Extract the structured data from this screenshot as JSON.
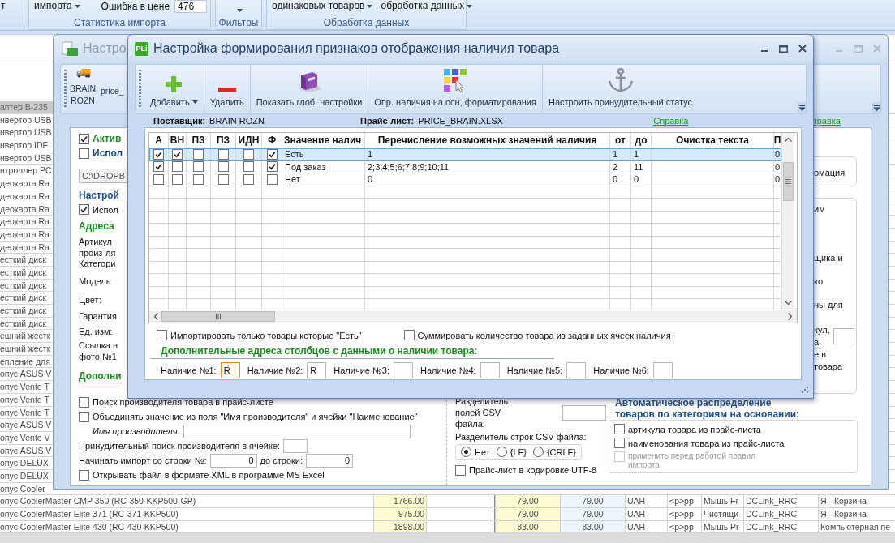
{
  "ribbon": {
    "fragment": "т",
    "groups": [
      {
        "label": "Статистика импорта",
        "items": [
          {
            "kind": "menu-button",
            "label": "импорта"
          },
          {
            "kind": "field",
            "label": "Ошибка в цене",
            "value": "476"
          }
        ]
      },
      {
        "label": "Фильтры",
        "items": [
          {
            "kind": "caret-button"
          }
        ]
      },
      {
        "label": "Обработка данных",
        "items": [
          {
            "kind": "menu-button",
            "label": "одинаковых товаров"
          },
          {
            "kind": "menu-button",
            "label": "обработка данных"
          }
        ]
      }
    ]
  },
  "product_list": {
    "rows": [
      {
        "name": "аптер B-235",
        "selected": true
      },
      {
        "name": "нвертор USB",
        "selected": false
      },
      {
        "name": "нвертор USB",
        "selected": false
      },
      {
        "name": "нвертор IDE",
        "selected": false
      },
      {
        "name": "нвертор USB",
        "selected": false
      },
      {
        "name": "нтроллер PC",
        "selected": false
      },
      {
        "name": "деокарта Ra",
        "selected": false
      },
      {
        "name": "деокарта Ra",
        "selected": false
      },
      {
        "name": "деокарта Ra",
        "selected": false
      },
      {
        "name": "деокарта Ra",
        "selected": false
      },
      {
        "name": "деокарта Ra",
        "selected": false
      },
      {
        "name": "деокарта Ra",
        "selected": false
      },
      {
        "name": "есткий диск",
        "selected": false
      },
      {
        "name": "есткий диск",
        "selected": false
      },
      {
        "name": "есткий диск",
        "selected": false
      },
      {
        "name": "есткий диск",
        "selected": false
      },
      {
        "name": "есткий диск",
        "selected": false
      },
      {
        "name": "есткий диск",
        "selected": false
      },
      {
        "name": "ешний жестк",
        "selected": false
      },
      {
        "name": "ешний жестк",
        "selected": false
      },
      {
        "name": "епление для",
        "selected": false
      },
      {
        "name": "опус ASUS V",
        "selected": false
      },
      {
        "name": "опус Vento T",
        "selected": false
      },
      {
        "name": "опус Vento T",
        "selected": false
      },
      {
        "name": "опус Vento T",
        "selected": false
      },
      {
        "name": "опус ASUS V",
        "selected": false
      },
      {
        "name": "опус Vento V",
        "selected": false
      },
      {
        "name": "опус ASUS V",
        "selected": false
      },
      {
        "name": "опус DELUX",
        "selected": false
      },
      {
        "name": "опус DELUX",
        "selected": false
      },
      {
        "name": "опус Cooler",
        "selected": false
      },
      {
        "name": "опус CoolerMaster CMP 350 (RC-350-KKP500-GP)",
        "selected": false,
        "cells": [
          "1766.00",
          "79.00",
          "79.00",
          "UAH",
          "<p>pp",
          "Мышь Fr",
          "DCLink_RRC",
          "Я - Корзина"
        ]
      },
      {
        "name": "опус CoolerMaster Elite 371 (RC-371-KKP500)",
        "selected": false,
        "cells": [
          "975.00",
          "79.00",
          "79.00",
          "UAH",
          "<p>pp",
          "Чистящи",
          "DCLink_RRC",
          "Я - Корзина"
        ]
      },
      {
        "name": "опус CoolerMaster Elite 430 (RC-430-KKP500)",
        "selected": false,
        "cells": [
          "1898.00",
          "83.00",
          "83.00",
          "UAH",
          "<p>pp",
          "Мышь Pr",
          "DCLink_RRC",
          "Компьютерная пе"
        ]
      }
    ]
  },
  "back_window": {
    "title": "Настро",
    "toolbar": [
      {
        "kind": "truck",
        "label": "BRAIN ROZN"
      },
      {
        "kind": "text",
        "label": "price_"
      }
    ],
    "help_link": "правка",
    "left_items": [
      {
        "kind": "main-checkbox",
        "label": "Актив",
        "checked": true
      },
      {
        "kind": "option-checkbox",
        "label": "Испол",
        "checked": false
      },
      {
        "kind": "path",
        "value": "C:\\DROPB"
      },
      {
        "kind": "group-title",
        "label": "Настрой"
      },
      {
        "kind": "checkbox",
        "label": "Испол",
        "checked": true
      },
      {
        "kind": "heading",
        "label": "Адреса"
      },
      {
        "kind": "label",
        "label": "Артикул произ-ля"
      },
      {
        "kind": "label",
        "label": "Категори"
      },
      {
        "kind": "label",
        "label": "Модель:"
      },
      {
        "kind": "label",
        "label": "Цвет:"
      },
      {
        "kind": "label",
        "label": "Гарантия"
      },
      {
        "kind": "label",
        "label": "Ед. изм:"
      },
      {
        "kind": "label",
        "label": "Ссылка н фото №1"
      },
      {
        "kind": "heading",
        "label": "Дополни"
      }
    ],
    "right_boxes": [
      {
        "items": [
          {
            "kind": "label",
            "label": "омация"
          }
        ]
      },
      {
        "items": [
          {
            "kind": "label",
            "label": "им"
          },
          {
            "kind": "label",
            "label": "щика и"
          },
          {
            "kind": "label",
            "label": "ко"
          },
          {
            "kind": "label",
            "label": "ны для"
          },
          {
            "kind": "field-label",
            "label": "кул, а:"
          },
          {
            "kind": "label",
            "label": "е в товара"
          }
        ]
      }
    ],
    "bottom_left": [
      {
        "kind": "checkbox",
        "label": "Поиск производителя товара в прайс-листе",
        "checked": false
      },
      {
        "kind": "checkbox",
        "label": "Объединять значение из поля \"Имя производителя\" и ячейки \"Наименование\"",
        "checked": false
      },
      {
        "kind": "indented-input",
        "label": "Имя производителя:"
      },
      {
        "kind": "input",
        "label": "Принудительный поиск производителя в ячейке:"
      },
      {
        "kind": "range",
        "label": "Начинать импорт со строки №:",
        "value": "0",
        "label2": "до строки:",
        "value2": "0"
      },
      {
        "kind": "checkbox",
        "label": "Открывать файл в формате XML в программе MS Excel",
        "checked": false
      }
    ],
    "csv": {
      "field_separator": "Разделитель полей CSV файла:",
      "line_separator": "Разделитель строк CSV файла:",
      "options": [
        {
          "label": "Нет",
          "selected": true
        },
        {
          "label": "{LF}",
          "selected": false
        },
        {
          "label": "{CRLF}",
          "selected": false
        }
      ],
      "utf8": {
        "label": "Прайс-лист в кодировке UTF-8",
        "checked": false
      }
    },
    "auto": {
      "title": "Автоматическое распределение товаров по категориям на основании:",
      "options": [
        {
          "label": "артикула товара из прайс-листа",
          "checked": false,
          "disabled": false
        },
        {
          "label": "наименования товара из прайс-листа",
          "checked": false,
          "disabled": false
        },
        {
          "label": "применить перед работой правил импорта",
          "checked": false,
          "disabled": true
        }
      ]
    }
  },
  "dialog": {
    "logo": "PLi",
    "title": "Настройка формирования признаков отображения наличия товара",
    "toolbar": [
      {
        "kind": "add",
        "label": "Добавить",
        "dropdown": true
      },
      {
        "kind": "remove",
        "label": "Удалить",
        "dropdown": false
      },
      {
        "kind": "book",
        "label": "Показать глоб. настройки",
        "dropdown": false
      },
      {
        "kind": "palette",
        "label": "Опр. наличия на осн, форматирования",
        "dropdown": false
      },
      {
        "kind": "anchor",
        "label": "Настроить принудительный статус",
        "dropdown": false
      }
    ],
    "supplier_label": "Поставщик:",
    "supplier": "BRAIN ROZN",
    "pricelist_label": "Прайс-лист:",
    "pricelist": "PRICE_BRAIN.XLSX",
    "help_link": "Справка",
    "grid": {
      "columns": [
        "А",
        "ВН",
        "ПЗ",
        "ПЗ",
        "ИДН",
        "Ф",
        "Значение налич",
        "Перечисление возможных значений наличия",
        "от",
        "до",
        "Очистка текста",
        "П"
      ],
      "rows": [
        {
          "selected": true,
          "checks": [
            true,
            true,
            false,
            false,
            false,
            true
          ],
          "availability": "Есть",
          "possible_values": "1",
          "from": "1",
          "to": "1",
          "column_12": "0"
        },
        {
          "selected": false,
          "checks": [
            true,
            false,
            false,
            false,
            false,
            true
          ],
          "availability": "Под заказ",
          "possible_values": "2;3;4;5;6;7;8;9;10;11",
          "from": "2",
          "to": "11",
          "column_12": "0"
        },
        {
          "selected": false,
          "checks": [
            false,
            false,
            false,
            false,
            false,
            false
          ],
          "availability": "Нет",
          "possible_values": "0",
          "from": "0",
          "to": "0",
          "column_12": "0"
        }
      ]
    },
    "only_available": {
      "label": "Импортировать только товары которые \"Есть\"",
      "checked": false
    },
    "sum_quantity": {
      "label": "Суммировать количество товара из заданных ячеек наличия",
      "checked": false
    },
    "extra_heading": "Дополнительные адреса столбцов с данными о наличии товара:",
    "extra_fields": [
      {
        "label": "Наличие №1:",
        "value": "R",
        "focused": true
      },
      {
        "label": "Наличие №2:",
        "value": "R",
        "focused": false
      },
      {
        "label": "Наличие №3:",
        "focused": false
      },
      {
        "label": "Наличие №4:",
        "focused": false
      },
      {
        "label": "Наличие №5:",
        "focused": false
      },
      {
        "label": "Наличие №6:",
        "focused": false
      }
    ]
  }
}
